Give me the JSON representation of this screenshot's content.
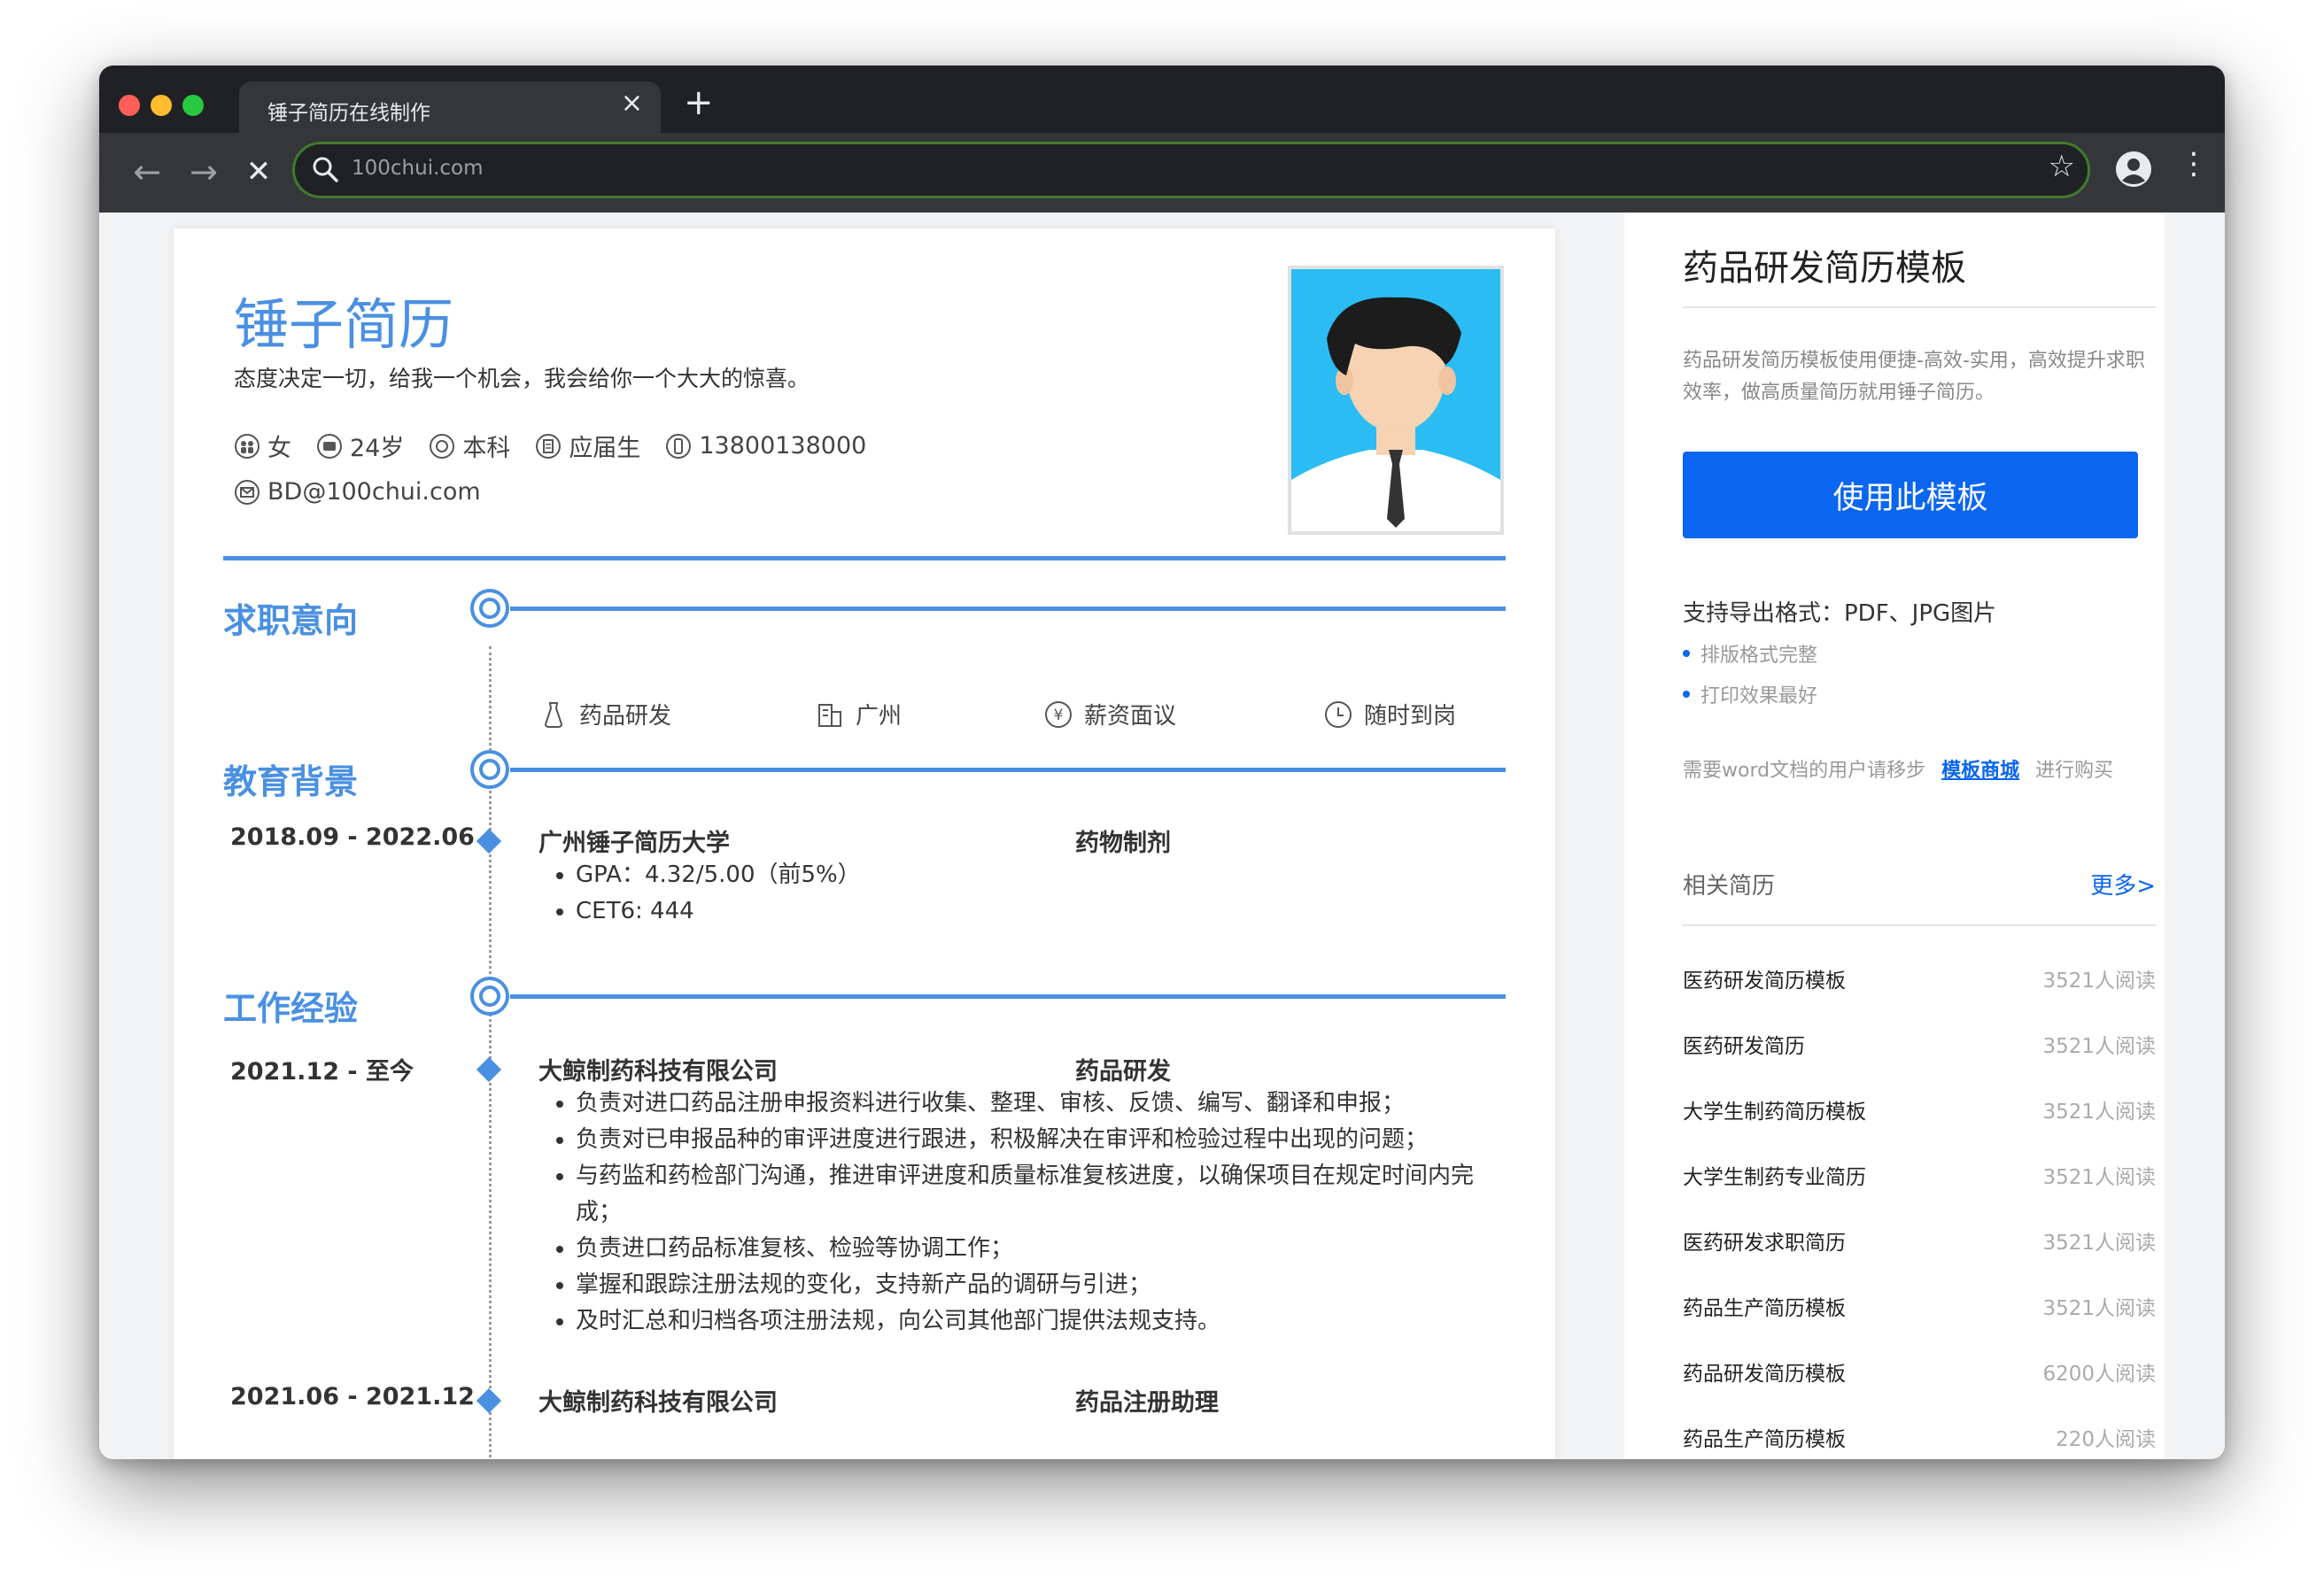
{
  "browser": {
    "tab_title": "锤子简历在线制作",
    "tab_close": "×",
    "new_tab": "+",
    "url": "100chui.com",
    "back": "←",
    "forward": "→",
    "stop": "✕",
    "star": "☆",
    "kebab": "⋮"
  },
  "resume": {
    "name": "锤子简历",
    "slogan": "态度决定一切，给我一个机会，我会给你一个大大的惊喜。",
    "info": {
      "gender": "女",
      "age": "24岁",
      "degree": "本科",
      "status": "应届生",
      "phone": "13800138000",
      "email": "BD@100chui.com"
    },
    "sections": {
      "intent": "求职意向",
      "education": "教育背景",
      "work": "工作经验"
    },
    "intent": {
      "position": "药品研发",
      "city": "广州",
      "salary": "薪资面议",
      "availability": "随时到岗"
    },
    "education": {
      "date": "2018.09 - 2022.06",
      "school": "广州锤子简历大学",
      "major": "药物制剂",
      "items": [
        "GPA：4.32/5.00（前5%）",
        "CET6: 444"
      ]
    },
    "work": [
      {
        "date": "2021.12 - 至今",
        "company": "大鲸制药科技有限公司",
        "role": "药品研发",
        "duties": [
          "负责对进口药品注册申报资料进行收集、整理、审核、反馈、编写、翻译和申报；",
          "负责对已申报品种的审评进度进行跟进，积极解决在审评和检验过程中出现的问题；",
          "与药监和药检部门沟通，推进审评进度和质量标准复核进度，以确保项目在规定时间内完成；",
          "负责进口药品标准复核、检验等协调工作；",
          "掌握和跟踪注册法规的变化，支持新产品的调研与引进；",
          "及时汇总和归档各项注册法规，向公司其他部门提供法规支持。"
        ]
      },
      {
        "date": "2021.06 - 2021.12",
        "company": "大鲸制药科技有限公司",
        "role": "药品注册助理"
      }
    ]
  },
  "sidebar": {
    "title": "药品研发简历模板",
    "desc": "药品研发简历模板使用便捷-高效-实用，高效提升求职效率，做高质量简历就用锤子简历。",
    "use_button": "使用此模板",
    "formats": "支持导出格式：PDF、JPG图片",
    "features": [
      "排版格式完整",
      "打印效果最好"
    ],
    "word_note_pre": "需要word文档的用户请移步",
    "word_note_link": "模板商城",
    "word_note_post": "进行购买",
    "related_title": "相关简历",
    "related_more": "更多>",
    "related": [
      {
        "name": "医药研发简历模板",
        "count": "3521人阅读"
      },
      {
        "name": "医药研发简历",
        "count": "3521人阅读"
      },
      {
        "name": "大学生制药简历模板",
        "count": "3521人阅读"
      },
      {
        "name": "大学生制药专业简历",
        "count": "3521人阅读"
      },
      {
        "name": "医药研发求职简历",
        "count": "3521人阅读"
      },
      {
        "name": "药品生产简历模板",
        "count": "3521人阅读"
      },
      {
        "name": "药品研发简历模板",
        "count": "6200人阅读"
      },
      {
        "name": "药品生产简历模板",
        "count": "220人阅读"
      }
    ]
  },
  "colors": {
    "accent": "#4a90e2",
    "button": "#0a66f0",
    "photo_bg": "#2bbcf4"
  }
}
